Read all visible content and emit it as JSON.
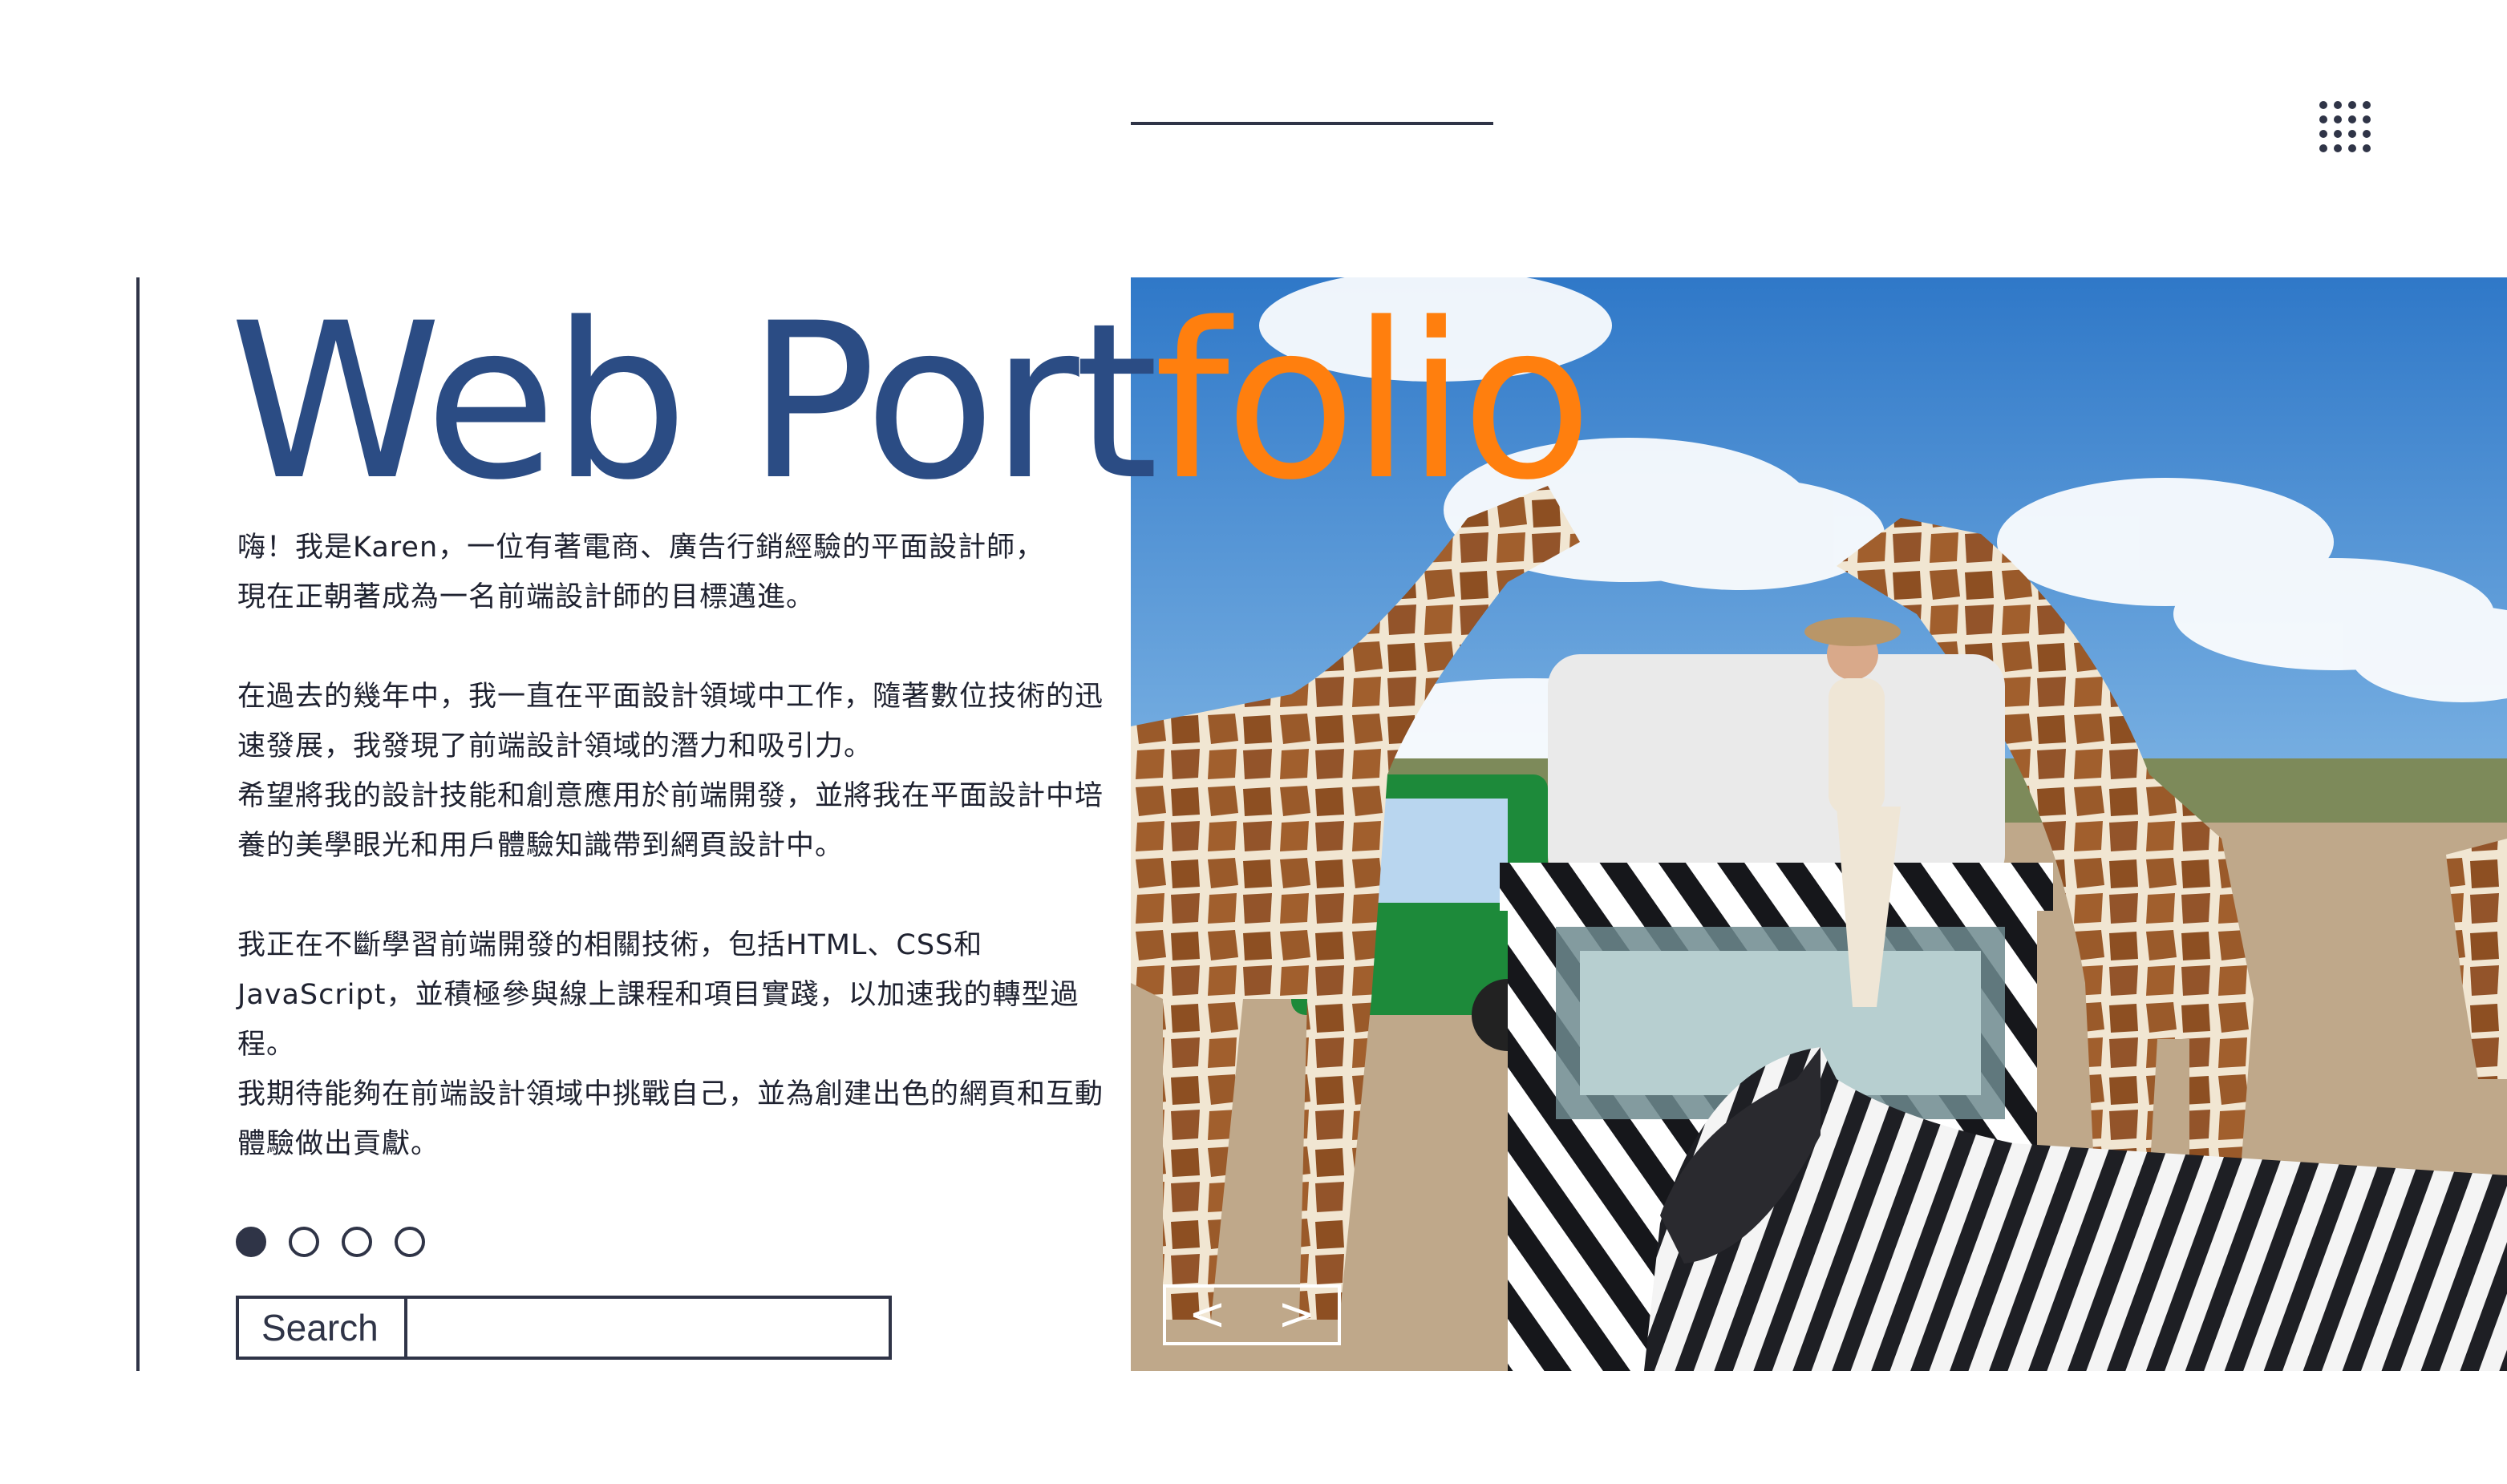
{
  "header": {
    "title_part1": "Web Port",
    "title_part2": "folio",
    "menu_icon": "grid-menu-icon"
  },
  "intro": {
    "paragraphs": [
      "嗨！我是Karen，一位有著電商、廣告行銷經驗的平面設計師，\n現在正朝著成為一名前端設計師的目標邁進。",
      "在過去的幾年中，我一直在平面設計領域中工作，隨著數位技術的迅速發展，我發現了前端設計領域的潛力和吸引力。\n希望將我的設計技能和創意應用於前端開發，並將我在平面設計中培養的美學眼光和用戶體驗知識帶到網頁設計中。",
      "我正在不斷學習前端開發的相關技術，包括HTML、CSS和JavaScript，並積極參與線上課程和項目實踐，以加速我的轉型過程。\n我期待能夠在前端設計領域中挑戰自己，並為創建出色的網頁和互動體驗做出貢獻。"
    ]
  },
  "pagination": {
    "total": 4,
    "active": 0
  },
  "search": {
    "label": "Search",
    "value": "",
    "placeholder": ""
  },
  "carousel": {
    "prev_icon": "chevron-left-icon",
    "next_icon": "chevron-right-icon",
    "prev": "<",
    "next": ">"
  },
  "colors": {
    "accent": "#ff7f0e",
    "primary": "#2b4c84",
    "dark": "#2f3447"
  }
}
